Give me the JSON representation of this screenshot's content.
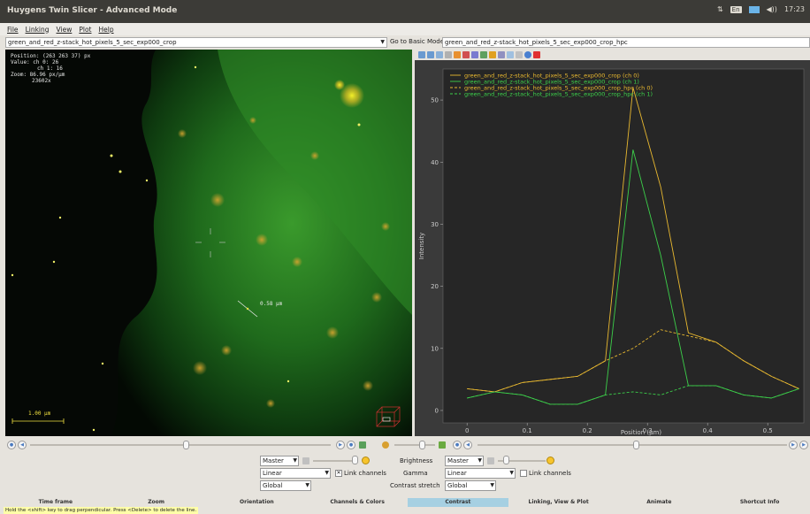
{
  "window": {
    "title": "Huygens Twin Slicer - Advanced Mode"
  },
  "tray": {
    "keyboard": "En",
    "volume": "◀))",
    "clock": "17:23"
  },
  "menu": [
    "File",
    "Linking",
    "View",
    "Plot",
    "Help"
  ],
  "files": {
    "left": "green_and_red_z-stack_hot_pixels_5_sec_exp000_crop",
    "basic_mode": "Go to Basic Mode",
    "right": "green_and_red_z-stack_hot_pixels_5_sec_exp000_crop_hpc"
  },
  "image_overlay": {
    "position": "Position: (263 263 37) px",
    "value_ch0": "Value: ch 0: 26",
    "value_ch1": "ch 1: 16",
    "zoom": "Zoom: 86.96 px/µm",
    "zoom2": "23602x",
    "line_label": "0.58 µm",
    "scale_label": "1.00 µm"
  },
  "chart_data": {
    "type": "line",
    "xlabel": "Position (µm)",
    "ylabel": "Intensity",
    "xlim": [
      -0.04,
      0.56
    ],
    "ylim": [
      -2,
      55
    ],
    "xticks": [
      "0",
      "0.1",
      "0.2",
      "0.3",
      "0.4",
      "0.5"
    ],
    "xtick_values": [
      0,
      0.1,
      0.2,
      0.3,
      0.4,
      0.5
    ],
    "yticks": [
      "0",
      "10",
      "20",
      "30",
      "40",
      "50"
    ],
    "ytick_values": [
      0,
      10,
      20,
      30,
      40,
      50
    ],
    "x": [
      0,
      0.046,
      0.092,
      0.138,
      0.184,
      0.23,
      0.276,
      0.322,
      0.368,
      0.414,
      0.46,
      0.506,
      0.552
    ],
    "series": [
      {
        "name": "green_and_red_z-stack_hot_pixels_5_sec_exp000_crop (ch 0)",
        "color": "#e8b830",
        "dash": "solid",
        "values": [
          3.5,
          3,
          4.5,
          5,
          5.5,
          8,
          52,
          36,
          12.5,
          11,
          8,
          5.5,
          3.5
        ]
      },
      {
        "name": "green_and_red_z-stack_hot_pixels_5_sec_exp000_crop (ch 1)",
        "color": "#3ccf4a",
        "dash": "solid",
        "values": [
          2,
          3,
          2.5,
          1,
          1,
          2.5,
          42,
          25,
          4,
          4,
          2.5,
          2,
          3.5
        ]
      },
      {
        "name": "green_and_red_z-stack_hot_pixels_5_sec_exp000_crop_hpc (ch 0)",
        "color": "#e8b830",
        "dash": "dashed",
        "values": [
          3.5,
          3,
          4.5,
          5,
          5.5,
          8,
          10,
          13,
          12,
          11,
          8,
          5.5,
          3.5
        ]
      },
      {
        "name": "green_and_red_z-stack_hot_pixels_5_sec_exp000_crop_hpc (ch 1)",
        "color": "#3ccf4a",
        "dash": "dashed",
        "values": [
          2,
          3,
          2.5,
          1,
          1,
          2.5,
          3,
          2.5,
          4,
          4,
          2.5,
          2,
          3.5
        ]
      }
    ]
  },
  "controls": {
    "master_left": "Master",
    "mode_left": "Linear",
    "scope_left": "Global",
    "link_channels_left": "Link channels",
    "link_checked_mark": "✕",
    "brightness": "Brightness",
    "gamma": "Gamma",
    "contrast_stretch": "Contrast stretch",
    "master_right": "Master",
    "mode_right": "Linear",
    "scope_right": "Global",
    "link_channels_right": "Link channels"
  },
  "tabs": [
    "Time frame",
    "Zoom",
    "Orientation",
    "Channels & Colors",
    "Contrast",
    "Linking, View & Plot",
    "Animate",
    "Shortcut Info"
  ],
  "active_tab": 4,
  "status": "Hold the <shift> key to drag perpendicular. Press <Delete> to delete the line."
}
